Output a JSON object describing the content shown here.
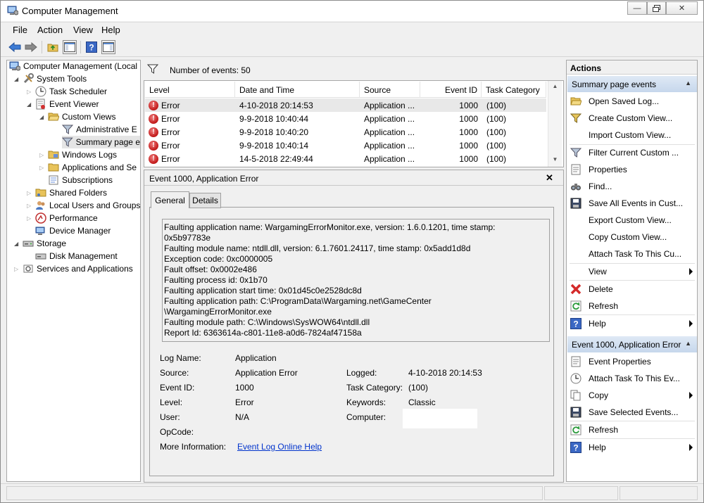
{
  "window": {
    "title": "Computer Management"
  },
  "menu": [
    "File",
    "Action",
    "View",
    "Help"
  ],
  "tree": [
    {
      "label": "Computer Management (Local"
    },
    {
      "label": "System Tools"
    },
    {
      "label": "Task Scheduler"
    },
    {
      "label": "Event Viewer"
    },
    {
      "label": "Custom Views"
    },
    {
      "label": "Administrative E"
    },
    {
      "label": "Summary page e"
    },
    {
      "label": "Windows Logs"
    },
    {
      "label": "Applications and Se"
    },
    {
      "label": "Subscriptions"
    },
    {
      "label": "Shared Folders"
    },
    {
      "label": "Local Users and Groups"
    },
    {
      "label": "Performance"
    },
    {
      "label": "Device Manager"
    },
    {
      "label": "Storage"
    },
    {
      "label": "Disk Management"
    },
    {
      "label": "Services and Applications"
    }
  ],
  "events": {
    "count_label": "Number of events: 50",
    "columns": [
      "Level",
      "Date and Time",
      "Source",
      "Event ID",
      "Task Category"
    ],
    "rows": [
      {
        "level": "Error",
        "date": "4-10-2018 20:14:53",
        "source": "Application ...",
        "id": "1000",
        "cat": "(100)"
      },
      {
        "level": "Error",
        "date": "9-9-2018 10:40:44",
        "source": "Application ...",
        "id": "1000",
        "cat": "(100)"
      },
      {
        "level": "Error",
        "date": "9-9-2018 10:40:20",
        "source": "Application ...",
        "id": "1000",
        "cat": "(100)"
      },
      {
        "level": "Error",
        "date": "9-9-2018 10:40:14",
        "source": "Application ...",
        "id": "1000",
        "cat": "(100)"
      },
      {
        "level": "Error",
        "date": "14-5-2018 22:49:44",
        "source": "Application ...",
        "id": "1000",
        "cat": "(100)"
      }
    ]
  },
  "detail": {
    "title": "Event 1000, Application Error",
    "close": "✕",
    "tabs": [
      "General",
      "Details"
    ],
    "description": [
      "Faulting application name: WargamingErrorMonitor.exe, version: 1.6.0.1201, time stamp:",
      "0x5b97783e",
      "Faulting module name: ntdll.dll, version: 6.1.7601.24117, time stamp: 0x5add1d8d",
      "Exception code: 0xc0000005",
      "Fault offset: 0x0002e486",
      "Faulting process id: 0x1b70",
      "Faulting application start time: 0x01d45c0e2528dc8d",
      "Faulting application path: C:\\ProgramData\\Wargaming.net\\GameCenter",
      "\\WargamingErrorMonitor.exe",
      "Faulting module path: C:\\Windows\\SysWOW64\\ntdll.dll",
      "Report Id: 6363614a-c801-11e8-a0d6-7824af47158a"
    ],
    "fields": {
      "log_name_label": "Log Name:",
      "log_name": "Application",
      "source_label": "Source:",
      "source": "Application Error",
      "logged_label": "Logged:",
      "logged": "4-10-2018 20:14:53",
      "event_id_label": "Event ID:",
      "event_id": "1000",
      "task_cat_label": "Task Category:",
      "task_cat": "(100)",
      "level_label": "Level:",
      "level": "Error",
      "keywords_label": "Keywords:",
      "keywords": "Classic",
      "user_label": "User:",
      "user": "N/A",
      "computer_label": "Computer:",
      "opcode_label": "OpCode:",
      "more_info_label": "More Information:",
      "more_info_link": "Event Log Online Help"
    }
  },
  "actions": {
    "title": "Actions",
    "section1": "Summary page events",
    "items1": [
      "Open Saved Log...",
      "Create Custom View...",
      "Import Custom View...",
      "Filter Current Custom ...",
      "Properties",
      "Find...",
      "Save All Events in Cust...",
      "Export Custom View...",
      "Copy Custom View...",
      "Attach Task To This Cu...",
      "View",
      "Delete",
      "Refresh",
      "Help"
    ],
    "section2": "Event 1000, Application Error",
    "items2": [
      "Event Properties",
      "Attach Task To This Ev...",
      "Copy",
      "Save Selected Events...",
      "Refresh",
      "Help"
    ]
  }
}
